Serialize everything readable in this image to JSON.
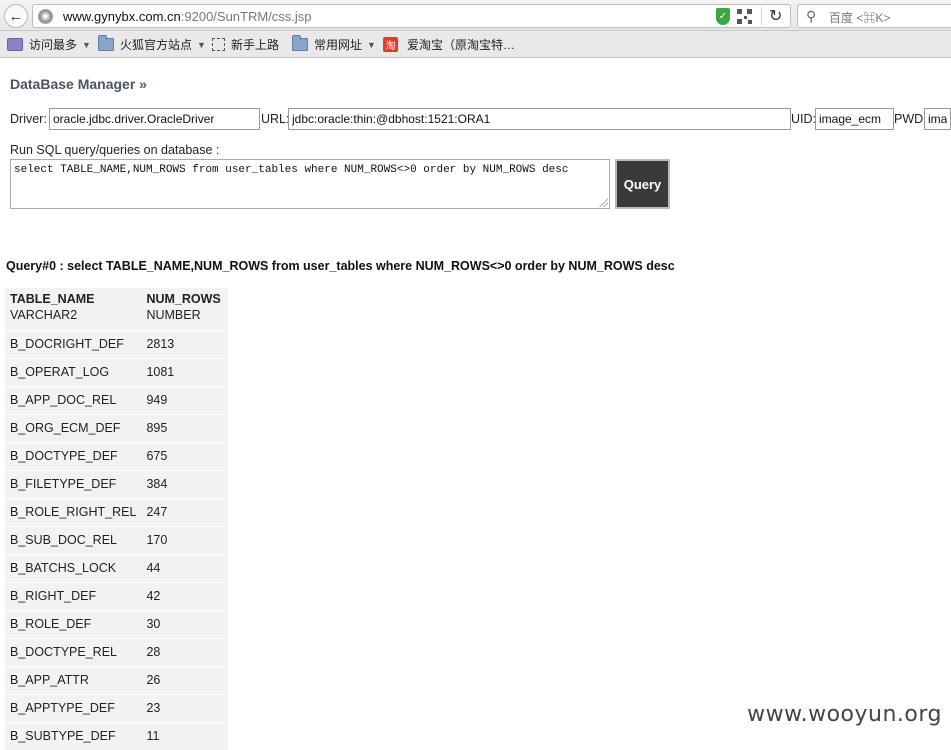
{
  "browser": {
    "url_host": "www.gynybx.com.cn",
    "url_rest": ":9200/SunTRM/css.jsp",
    "search_placeholder": "百度 <⌘K>",
    "bookmarks": [
      {
        "label": "访问最多",
        "icon": "most-visited-icon",
        "dropdown": true
      },
      {
        "label": "火狐官方站点",
        "icon": "folder-icon",
        "dropdown": true
      },
      {
        "label": "新手上路",
        "icon": "bookmark-page-icon",
        "dropdown": false
      },
      {
        "label": "常用网址",
        "icon": "folder-icon",
        "dropdown": true
      },
      {
        "label": "爱淘宝（原淘宝特…",
        "icon": "taobao-icon",
        "dropdown": false
      }
    ],
    "taobao_glyph": "淘"
  },
  "page": {
    "title": "DataBase Manager »",
    "driver_label": "Driver:",
    "driver_value": "oracle.jdbc.driver.OracleDriver",
    "url_label": "URL:",
    "url_value": "jdbc:oracle:thin:@dbhost:1521:ORA1",
    "uid_label": "UID:",
    "uid_value": "image_ecm",
    "pwd_label": "PWD:",
    "pwd_value": "image_ecm",
    "sql_label": "Run SQL query/queries on database :",
    "sql_value": "select TABLE_NAME,NUM_ROWS from user_tables where NUM_ROWS<>0 order by NUM_ROWS desc",
    "query_button": "Query",
    "query_heading": "Query#0 : select TABLE_NAME,NUM_ROWS from user_tables where NUM_ROWS<>0 order by NUM_ROWS desc"
  },
  "result": {
    "columns": [
      {
        "name": "TABLE_NAME",
        "type": "VARCHAR2"
      },
      {
        "name": "NUM_ROWS",
        "type": "NUMBER"
      }
    ],
    "rows": [
      [
        "B_DOCRIGHT_DEF",
        "2813"
      ],
      [
        "B_OPERAT_LOG",
        "1081"
      ],
      [
        "B_APP_DOC_REL",
        "949"
      ],
      [
        "B_ORG_ECM_DEF",
        "895"
      ],
      [
        "B_DOCTYPE_DEF",
        "675"
      ],
      [
        "B_FILETYPE_DEF",
        "384"
      ],
      [
        "B_ROLE_RIGHT_REL",
        "247"
      ],
      [
        "B_SUB_DOC_REL",
        "170"
      ],
      [
        "B_BATCHS_LOCK",
        "44"
      ],
      [
        "B_RIGHT_DEF",
        "42"
      ],
      [
        "B_ROLE_DEF",
        "30"
      ],
      [
        "B_DOCTYPE_REL",
        "28"
      ],
      [
        "B_APP_ATTR",
        "26"
      ],
      [
        "B_APPTYPE_DEF",
        "23"
      ],
      [
        "B_SUBTYPE_DEF",
        "11"
      ]
    ]
  },
  "watermark": "www.wooyun.org"
}
